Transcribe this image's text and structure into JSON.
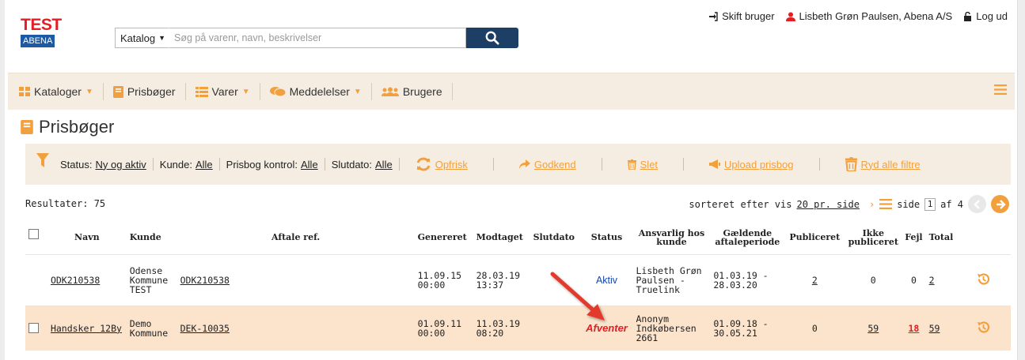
{
  "logo": {
    "test": "TEST",
    "abena": "ABENA"
  },
  "search": {
    "catalog_label": "Katalog",
    "placeholder": "Søg på varenr, navn, beskrivelser"
  },
  "user_menu": {
    "switch_user": "Skift bruger",
    "user_name": "Lisbeth Grøn Paulsen, Abena A/S",
    "logout": "Log ud"
  },
  "nav": {
    "kataloger": "Kataloger",
    "prisboger": "Prisbøger",
    "varer": "Varer",
    "meddelelser": "Meddelelser",
    "brugere": "Brugere"
  },
  "page": {
    "title": "Prisbøger"
  },
  "filters": {
    "status_label": "Status:",
    "status_value": "Ny og aktiv",
    "kunde_label": "Kunde:",
    "kunde_value": "Alle",
    "kontrol_label": "Prisbog kontrol:",
    "kontrol_value": "Alle",
    "slutdato_label": "Slutdato:",
    "slutdato_value": "Alle",
    "refresh": "Opfrisk",
    "approve": "Godkend",
    "delete": "Slet",
    "upload": "Upload prisbog",
    "clear": "Ryd alle filtre"
  },
  "results": {
    "label": "Resultater: 75"
  },
  "paging": {
    "sort_text": "sorteret efter vis",
    "per_page": "20 pr. side",
    "side": "side",
    "page": "1",
    "of": "af 4"
  },
  "table": {
    "headers": {
      "navn": "Navn",
      "kunde": "Kunde",
      "aftale_ref": "Aftale ref.",
      "genereret": "Genereret",
      "modtaget": "Modtaget",
      "slutdato": "Slutdato",
      "status": "Status",
      "ansvarlig_1": "Ansvarlig hos",
      "ansvarlig_2": "kunde",
      "periode_1": "Gældende",
      "periode_2": "aftaleperiode",
      "publiceret": "Publiceret",
      "ikke_1": "Ikke",
      "ikke_2": "publiceret",
      "fejl": "Fejl",
      "total": "Total"
    },
    "rows": [
      {
        "navn": "ODK210538",
        "kunde_1": "Odense",
        "kunde_2": "Kommune",
        "kunde_3": "TEST",
        "ref": "ODK210538",
        "gen_1": "11.09.15",
        "gen_2": "00:00",
        "mod_1": "28.03.19",
        "mod_2": "13:37",
        "slutdato": "",
        "status": "Aktiv",
        "ans_1": "Lisbeth Grøn",
        "ans_2": "Paulsen -",
        "ans_3": "Truelink",
        "per_1": "01.03.19 -",
        "per_2": "28.03.20",
        "publiceret": "2",
        "ikke": "0",
        "fejl": "0",
        "total": "2"
      },
      {
        "navn": "Handsker 12By",
        "kunde_1": "Demo",
        "kunde_2": "Kommune",
        "ref": "DEK-10035",
        "gen_1": "01.09.11",
        "gen_2": "00:00",
        "mod_1": "11.03.19",
        "mod_2": "08:20",
        "slutdato": "",
        "status": "Afventer",
        "ans_1": "Anonym",
        "ans_2": "Indkøbersen",
        "ans_3": "2661",
        "per_1": "01.09.18 -",
        "per_2": "30.05.21",
        "publiceret": "0",
        "ikke": "59",
        "fejl": "18",
        "total": "59"
      }
    ]
  },
  "colors": {
    "accent": "#f2a03d",
    "brand_red": "#e31e24",
    "brand_blue": "#1e5aa3",
    "highlight_row": "#fbe3cc",
    "status_active": "#1747a6"
  },
  "icons": [
    "filter-icon",
    "refresh-icon",
    "share-arrow-icon",
    "trash-icon",
    "megaphone-icon",
    "history-icon",
    "search-icon",
    "signin-icon",
    "user-icon",
    "lock-icon",
    "grid-icon",
    "book-icon",
    "list-icon",
    "chat-icon",
    "users-icon",
    "hamburger-icon",
    "chevron-right-icon",
    "prev-page-icon",
    "next-page-icon",
    "annotation-arrow"
  ]
}
